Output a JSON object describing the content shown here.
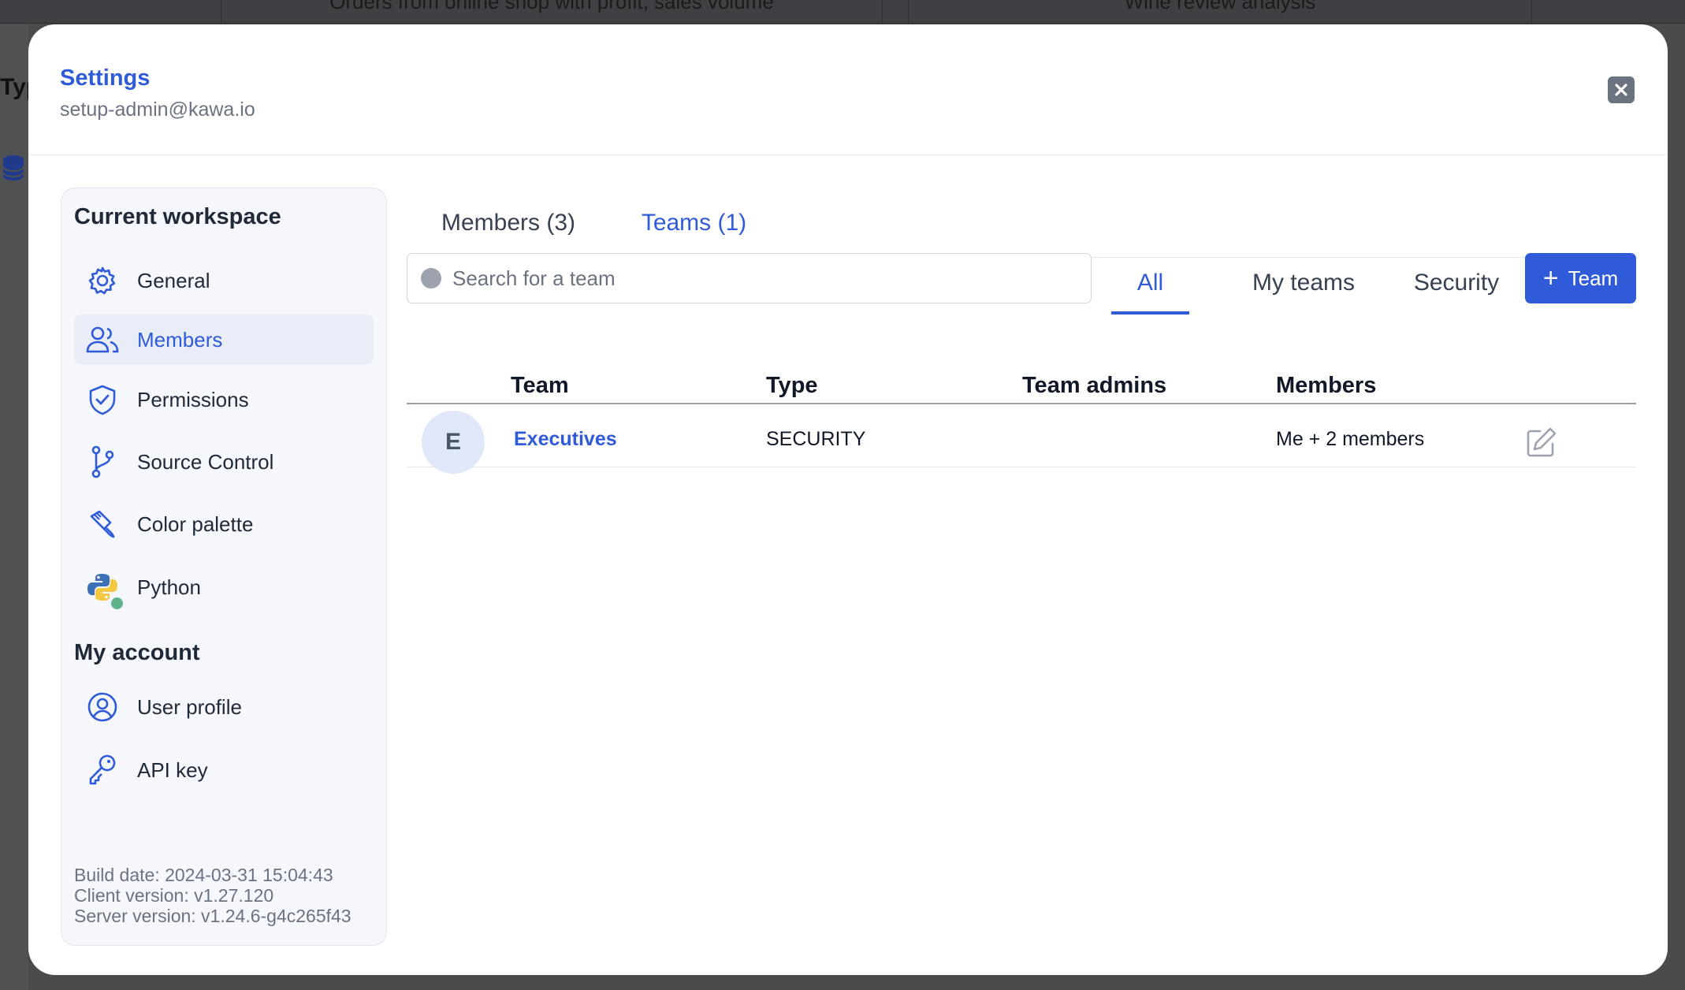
{
  "background": {
    "top_tabs": [
      "Orders from online shop with profit, sales volume",
      "Wine review analysis"
    ],
    "left_header_fragment": "Typ"
  },
  "modal": {
    "title": "Settings",
    "subtitle": "setup-admin@kawa.io",
    "close_icon": "close-icon"
  },
  "sidebar": {
    "workspace_heading": "Current workspace",
    "workspace_items": [
      {
        "label": "General",
        "icon": "gear-icon"
      },
      {
        "label": "Members",
        "icon": "users-icon",
        "active": true
      },
      {
        "label": "Permissions",
        "icon": "shield-check-icon"
      },
      {
        "label": "Source Control",
        "icon": "git-branch-icon"
      },
      {
        "label": "Color palette",
        "icon": "paint-brush-icon"
      },
      {
        "label": "Python",
        "icon": "python-icon"
      }
    ],
    "account_heading": "My account",
    "account_items": [
      {
        "label": "User profile",
        "icon": "user-circle-icon"
      },
      {
        "label": "API key",
        "icon": "key-icon"
      }
    ],
    "build_info": {
      "build_date": "Build date: 2024-03-31 15:04:43",
      "client_version": "Client version: v1.27.120",
      "server_version": "Server version: v1.24.6-g4c265f43"
    }
  },
  "main": {
    "tabs": [
      {
        "label": "Members (3)"
      },
      {
        "label": "Teams (1)",
        "active": true
      }
    ],
    "search": {
      "placeholder": "Search for a team",
      "value": ""
    },
    "filters": [
      {
        "label": "All",
        "active": true
      },
      {
        "label": "My teams"
      },
      {
        "label": "Security"
      }
    ],
    "add_button": {
      "label": "Team",
      "icon": "plus-icon"
    },
    "table": {
      "columns": [
        "Team",
        "Type",
        "Team admins",
        "Members"
      ],
      "rows": [
        {
          "avatar": "E",
          "team": "Executives",
          "type": "SECURITY",
          "admins": "",
          "members": "Me + 2 members"
        }
      ]
    }
  },
  "colors": {
    "accent": "#2f5bd9",
    "python_status": "#5fb38a"
  }
}
